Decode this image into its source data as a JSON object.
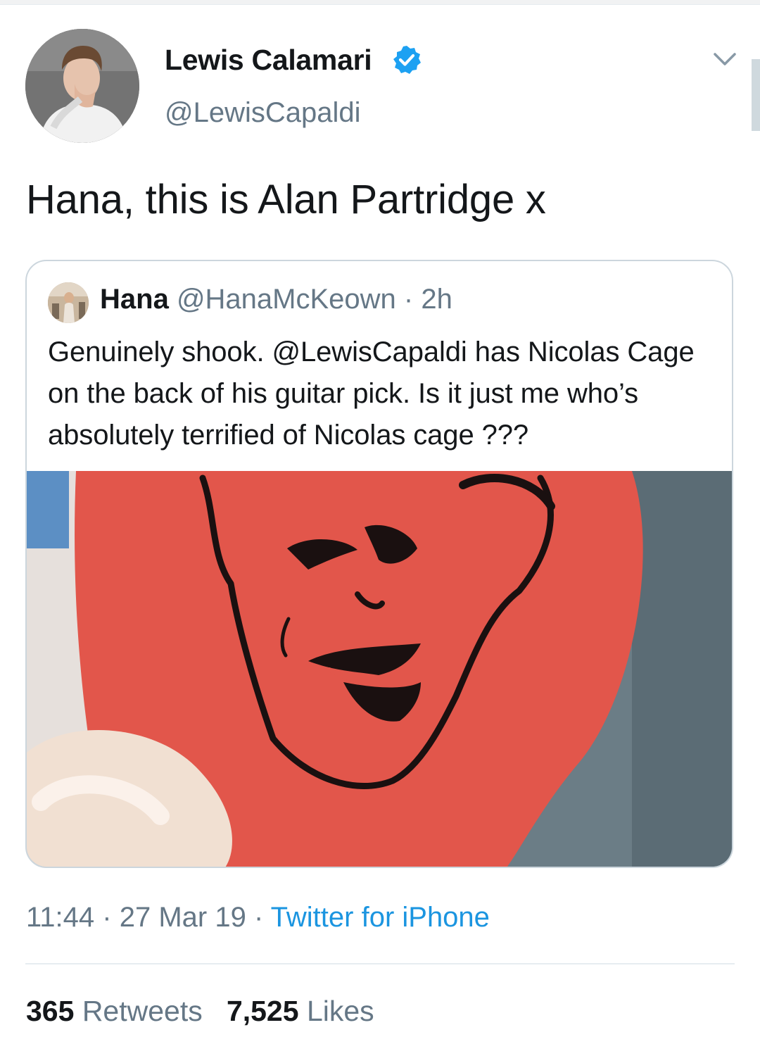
{
  "author": {
    "display_name": "Lewis Calamari",
    "handle": "@LewisCapaldi",
    "verified": true
  },
  "tweet": {
    "text": "Hana, this is Alan Partridge x",
    "time": "11:44",
    "date": "27 Mar 19",
    "source": "Twitter for iPhone",
    "separator": "·"
  },
  "quoted_tweet": {
    "name": "Hana",
    "handle": "@HanaMcKeown",
    "age": "2h",
    "separator": "·",
    "text": "Genuinely shook. @LewisCapaldi has Nicolas Cage on the back of his guitar pick. Is it just me who’s absolutely terrified of Nicolas cage ???",
    "media": "photo of red guitar pick with drawn face"
  },
  "stats": {
    "retweets_count": "365",
    "retweets_label": "Retweets",
    "likes_count": "7,525",
    "likes_label": "Likes"
  },
  "colors": {
    "link": "#1b95e0",
    "verified": "#1da1f2",
    "secondary_text": "#657786",
    "pick_red": "#e2564b"
  },
  "icons": {
    "verified": "verified-badge-icon",
    "more": "chevron-down-icon"
  }
}
